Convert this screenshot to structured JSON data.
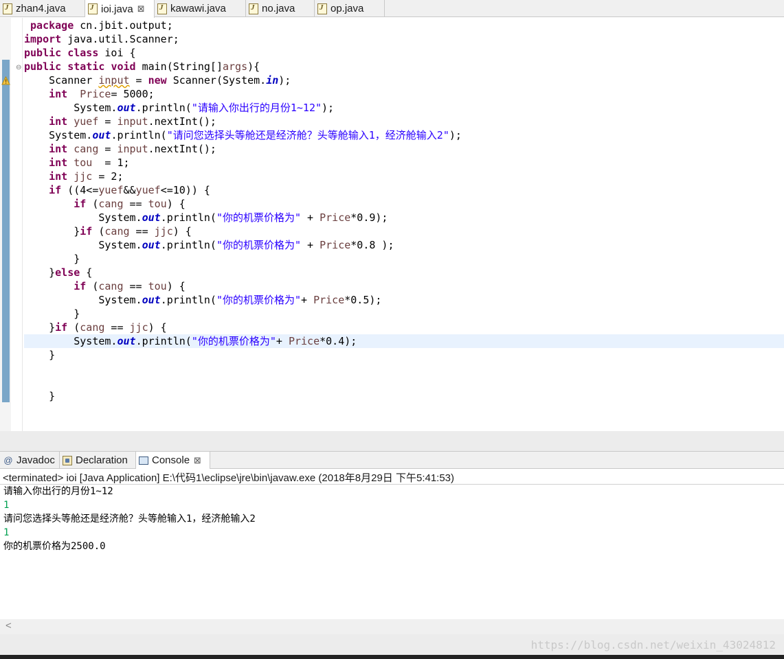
{
  "editor_tabs": [
    {
      "label": "zhan4.java",
      "active": false
    },
    {
      "label": "ioi.java",
      "active": true,
      "close": "⊠"
    },
    {
      "label": "kawawi.java",
      "active": false
    },
    {
      "label": "no.java",
      "active": false
    },
    {
      "label": "op.java",
      "active": false
    }
  ],
  "code_lines": [
    [
      [
        " ",
        "p"
      ],
      [
        "package",
        "kw"
      ],
      [
        " cn.jbit.output;",
        "p"
      ]
    ],
    [
      [
        "import",
        "kw"
      ],
      [
        " java.util.Scanner;",
        "p"
      ]
    ],
    [
      [
        "public",
        "kw"
      ],
      [
        " ",
        "p"
      ],
      [
        "class",
        "kw"
      ],
      [
        " ioi {",
        "p"
      ]
    ],
    [
      [
        "public",
        "kw"
      ],
      [
        " ",
        "p"
      ],
      [
        "static",
        "kw"
      ],
      [
        " ",
        "p"
      ],
      [
        "void",
        "kw"
      ],
      [
        " main(String[]",
        "p"
      ],
      [
        "args",
        "lv"
      ],
      [
        "){",
        "p"
      ]
    ],
    [
      [
        "    Scanner ",
        "p"
      ],
      [
        "input",
        "lvw"
      ],
      [
        " = ",
        "p"
      ],
      [
        "new",
        "kw"
      ],
      [
        " Scanner(System.",
        "p"
      ],
      [
        "in",
        "fi"
      ],
      [
        ");",
        "p"
      ]
    ],
    [
      [
        "    ",
        "p"
      ],
      [
        "int",
        "kw"
      ],
      [
        "  ",
        "p"
      ],
      [
        "Price",
        "lv"
      ],
      [
        "= 5000;",
        "p"
      ]
    ],
    [
      [
        "        System.",
        "p"
      ],
      [
        "out",
        "fi"
      ],
      [
        ".println(",
        "p"
      ],
      [
        "\"请输入你出行的月份1~12\"",
        "st"
      ],
      [
        ");",
        "p"
      ]
    ],
    [
      [
        "    ",
        "p"
      ],
      [
        "int",
        "kw"
      ],
      [
        " ",
        "p"
      ],
      [
        "yuef",
        "lv"
      ],
      [
        " = ",
        "p"
      ],
      [
        "input",
        "lv"
      ],
      [
        ".nextInt();",
        "p"
      ]
    ],
    [
      [
        "    System.",
        "p"
      ],
      [
        "out",
        "fi"
      ],
      [
        ".println(",
        "p"
      ],
      [
        "\"请问您选择头等舱还是经济舱？头等舱输入1，经济舱输入2\"",
        "st"
      ],
      [
        ");",
        "p"
      ]
    ],
    [
      [
        "    ",
        "p"
      ],
      [
        "int",
        "kw"
      ],
      [
        " ",
        "p"
      ],
      [
        "cang",
        "lv"
      ],
      [
        " = ",
        "p"
      ],
      [
        "input",
        "lv"
      ],
      [
        ".nextInt();",
        "p"
      ]
    ],
    [
      [
        "    ",
        "p"
      ],
      [
        "int",
        "kw"
      ],
      [
        " ",
        "p"
      ],
      [
        "tou",
        "lv"
      ],
      [
        "  = 1;",
        "p"
      ]
    ],
    [
      [
        "    ",
        "p"
      ],
      [
        "int",
        "kw"
      ],
      [
        " ",
        "p"
      ],
      [
        "jjc",
        "lv"
      ],
      [
        " = 2;",
        "p"
      ]
    ],
    [
      [
        "    ",
        "p"
      ],
      [
        "if",
        "kw"
      ],
      [
        " ((4<=",
        "p"
      ],
      [
        "yuef",
        "lv"
      ],
      [
        "&&",
        "p"
      ],
      [
        "yuef",
        "lv"
      ],
      [
        "<=10)) {",
        "p"
      ]
    ],
    [
      [
        "        ",
        "p"
      ],
      [
        "if",
        "kw"
      ],
      [
        " (",
        "p"
      ],
      [
        "cang",
        "lv"
      ],
      [
        " == ",
        "p"
      ],
      [
        "tou",
        "lv"
      ],
      [
        ") {",
        "p"
      ]
    ],
    [
      [
        "            System.",
        "p"
      ],
      [
        "out",
        "fi"
      ],
      [
        ".println(",
        "p"
      ],
      [
        "\"你的机票价格为\"",
        "st"
      ],
      [
        " + ",
        "p"
      ],
      [
        "Price",
        "lv"
      ],
      [
        "*0.9);",
        "p"
      ]
    ],
    [
      [
        "        }",
        "p"
      ],
      [
        "if",
        "kw"
      ],
      [
        " (",
        "p"
      ],
      [
        "cang",
        "lv"
      ],
      [
        " == ",
        "p"
      ],
      [
        "jjc",
        "lv"
      ],
      [
        ") {",
        "p"
      ]
    ],
    [
      [
        "            System.",
        "p"
      ],
      [
        "out",
        "fi"
      ],
      [
        ".println(",
        "p"
      ],
      [
        "\"你的机票价格为\"",
        "st"
      ],
      [
        " + ",
        "p"
      ],
      [
        "Price",
        "lv"
      ],
      [
        "*0.8 );",
        "p"
      ]
    ],
    [
      [
        "        }",
        "p"
      ]
    ],
    [
      [
        "    }",
        "p"
      ],
      [
        "else",
        "kw"
      ],
      [
        " {",
        "p"
      ]
    ],
    [
      [
        "        ",
        "p"
      ],
      [
        "if",
        "kw"
      ],
      [
        " (",
        "p"
      ],
      [
        "cang",
        "lv"
      ],
      [
        " == ",
        "p"
      ],
      [
        "tou",
        "lv"
      ],
      [
        ") {",
        "p"
      ]
    ],
    [
      [
        "            System.",
        "p"
      ],
      [
        "out",
        "fi"
      ],
      [
        ".println(",
        "p"
      ],
      [
        "\"你的机票价格为\"",
        "st"
      ],
      [
        "+ ",
        "p"
      ],
      [
        "Price",
        "lv"
      ],
      [
        "*0.5);",
        "p"
      ]
    ],
    [
      [
        "        }",
        "p"
      ]
    ],
    [
      [
        "    }",
        "p"
      ],
      [
        "if",
        "kw"
      ],
      [
        " (",
        "p"
      ],
      [
        "cang",
        "lv"
      ],
      [
        " == ",
        "p"
      ],
      [
        "jjc",
        "lv"
      ],
      [
        ") {",
        "p"
      ]
    ],
    [
      [
        "        System.",
        "p"
      ],
      [
        "out",
        "fi"
      ],
      [
        ".println(",
        "p"
      ],
      [
        "\"你的机票价格为\"",
        "st"
      ],
      [
        "+ ",
        "p"
      ],
      [
        "Price",
        "lv"
      ],
      [
        "*0.4);",
        "p"
      ]
    ],
    [
      [
        "    }",
        "p"
      ]
    ],
    [
      [
        "",
        "p"
      ]
    ],
    [
      [
        "",
        "p"
      ]
    ],
    [
      [
        "    }",
        "p"
      ]
    ]
  ],
  "console_tabs": [
    {
      "label": "Javadoc",
      "icon": "@"
    },
    {
      "label": "Declaration",
      "icon": "declaration-icon"
    },
    {
      "label": "Console",
      "icon": "console-icon",
      "active": true,
      "close": "⊠"
    }
  ],
  "console": {
    "status": "<terminated> ioi [Java Application] E:\\代码1\\eclipse\\jre\\bin\\javaw.exe (2018年8月29日 下午5:41:53)",
    "lines": [
      {
        "text": "请输入你出行的月份1~12",
        "kind": "out"
      },
      {
        "text": "1",
        "kind": "in"
      },
      {
        "text": "请问您选择头等舱还是经济舱？头等舱输入1，经济舱输入2",
        "kind": "out"
      },
      {
        "text": "1",
        "kind": "in"
      },
      {
        "text": "你的机票价格为2500.0",
        "kind": "out"
      }
    ]
  },
  "watermark": "https://blog.csdn.net/weixin_43024812",
  "colors": {
    "keyword": "#7f0055",
    "string": "#2a00ff",
    "field": "#0000c0",
    "local_var": "#6a3e3e",
    "console_input": "#00a050",
    "current_line": "#e8f2fe"
  }
}
